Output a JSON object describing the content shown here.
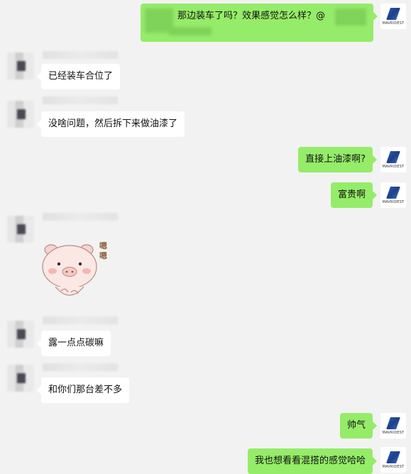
{
  "brand_colors": {
    "outgoing_bubble": "#95ec69",
    "incoming_bubble": "#ffffff",
    "background": "#f2f2f2"
  },
  "self_avatar_text": "MAVRIDEST",
  "messages": [
    {
      "id": "m1",
      "side": "out",
      "text": "那边装车了吗？效果感觉怎么样？@"
    },
    {
      "id": "m2",
      "side": "in",
      "text": "已经装车合位了"
    },
    {
      "id": "m3",
      "side": "in",
      "text": "没啥问题，然后拆下来做油漆了"
    },
    {
      "id": "m4",
      "side": "out",
      "text": "直接上油漆啊?"
    },
    {
      "id": "m5",
      "side": "out",
      "text": "富贵啊"
    },
    {
      "id": "m6",
      "side": "in",
      "type": "sticker",
      "sticker": "pig-sticker",
      "sticker_text": "嗯嗯"
    },
    {
      "id": "m7",
      "side": "in",
      "text": "露一点点碳嘛"
    },
    {
      "id": "m8",
      "side": "in",
      "text": "和你们那台差不多"
    },
    {
      "id": "m9",
      "side": "out",
      "text": "帅气"
    },
    {
      "id": "m10",
      "side": "out",
      "text": "我也想看看混搭的感觉哈哈"
    }
  ]
}
